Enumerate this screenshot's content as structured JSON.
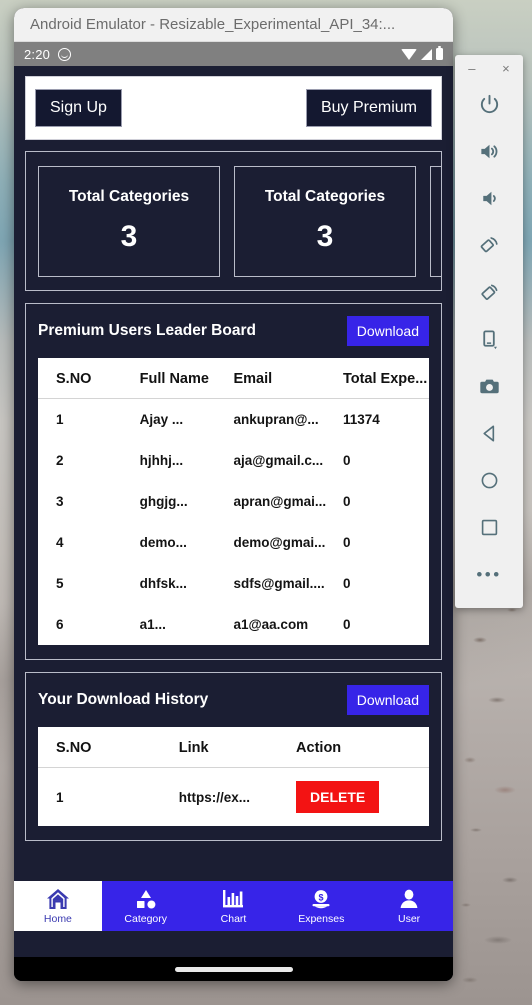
{
  "window": {
    "title": "Android Emulator - Resizable_Experimental_API_34:...",
    "minimize_label": "–",
    "close_label": "×"
  },
  "status_bar": {
    "clock": "2:20",
    "icons": [
      "smiley-icon",
      "wifi-icon",
      "signal-icon",
      "battery-icon"
    ]
  },
  "auth_bar": {
    "sign_up_label": "Sign Up",
    "buy_premium_label": "Buy Premium"
  },
  "stats": {
    "cards": [
      {
        "title": "Total Categories",
        "value": "3"
      },
      {
        "title": "Total Categories",
        "value": "3"
      },
      {
        "title": "",
        "value": ""
      }
    ]
  },
  "leaderboard": {
    "title": "Premium Users Leader Board",
    "download_label": "Download",
    "columns": [
      "S.NO",
      "Full Name",
      "Email",
      "Total Expe..."
    ],
    "rows": [
      {
        "sno": "1",
        "name": "Ajay ...",
        "email": "ankupran@...",
        "total": "11374"
      },
      {
        "sno": "2",
        "name": "hjhhj...",
        "email": "aja@gmail.c...",
        "total": "0"
      },
      {
        "sno": "3",
        "name": "ghgjg...",
        "email": "apran@gmai...",
        "total": "0"
      },
      {
        "sno": "4",
        "name": "demo...",
        "email": "demo@gmai...",
        "total": "0"
      },
      {
        "sno": "5",
        "name": "dhfsk...",
        "email": "sdfs@gmail....",
        "total": "0"
      },
      {
        "sno": "6",
        "name": "a1...",
        "email": "a1@aa.com",
        "total": "0"
      }
    ]
  },
  "download_history": {
    "title": "Your Download History",
    "download_label": "Download",
    "columns": [
      "S.NO",
      "Link",
      "Action"
    ],
    "rows": [
      {
        "sno": "1",
        "link": "https://ex...",
        "action_label": "DELETE"
      }
    ]
  },
  "bottom_nav": {
    "items": [
      {
        "label": "Home",
        "icon": "home-icon",
        "active": true
      },
      {
        "label": "Category",
        "icon": "category-icon",
        "active": false
      },
      {
        "label": "Chart",
        "icon": "chart-icon",
        "active": false
      },
      {
        "label": "Expenses",
        "icon": "money-icon",
        "active": false
      },
      {
        "label": "User",
        "icon": "user-icon",
        "active": false
      }
    ]
  },
  "emulator_toolbar": {
    "buttons": [
      "power-icon",
      "volume-up-icon",
      "volume-down-icon",
      "rotate-left-icon",
      "rotate-right-icon",
      "fold-device-icon",
      "camera-icon",
      "back-icon",
      "home-circle-icon",
      "overview-square-icon",
      "more-icon"
    ]
  },
  "colors": {
    "app_background": "#1b1e33",
    "card_background": "#141830",
    "accent_blue": "#3724e8",
    "delete_red": "#f31313",
    "status_bar_grey": "#808080",
    "border_grey": "#b9bcc9"
  }
}
